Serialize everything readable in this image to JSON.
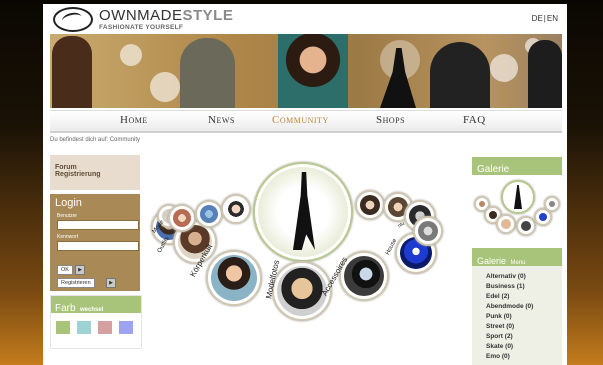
{
  "brand": {
    "name_part1": "OWNMADE",
    "name_part2": "STYLE",
    "tagline": "FASHIONATE YOURSELF"
  },
  "lang": [
    "DE",
    "EN"
  ],
  "nav": [
    {
      "label": "Home",
      "active": false
    },
    {
      "label": "News",
      "active": false
    },
    {
      "label": "Community",
      "active": true
    },
    {
      "label": "Shops",
      "active": false
    },
    {
      "label": "FAQ",
      "active": false
    }
  ],
  "breadcrumb": "Du befindest dich auf: Community",
  "left": {
    "forum": "Forum",
    "register": "Registrierung",
    "login_title": "Login",
    "user_label": "Benutzer",
    "pass_label": "Kennwort",
    "ok": "OK",
    "register_btn": "Registrieren",
    "arrow": "▶",
    "farb_title": "Farb",
    "farb_sub": "wechsel",
    "swatches": [
      "#a8c47a",
      "#9fd3d3",
      "#d4a0a0",
      "#9ea3f0"
    ]
  },
  "center": {
    "labels": {
      "koerperkult": "Körperkult",
      "modelfotos": "Modelfotos",
      "accessoires": "Accessoires",
      "mode": "Mode",
      "outfits": "Outfits",
      "house": "House",
      "nlu": "nlu"
    }
  },
  "right": {
    "galerie": "Galerie",
    "menu_title": "Galerie",
    "menu_sub": "Menu",
    "categories": [
      "Alternativ (0)",
      "Business (1)",
      "Edel (2)",
      "Abendmode (0)",
      "Punk (0)",
      "Street (0)",
      "Sport (2)",
      "Skate (0)",
      "Emo (0)"
    ]
  },
  "colors": {
    "accent_green": "#a8c47a",
    "accent_brown": "#a98955",
    "active_nav": "#b9863c"
  }
}
